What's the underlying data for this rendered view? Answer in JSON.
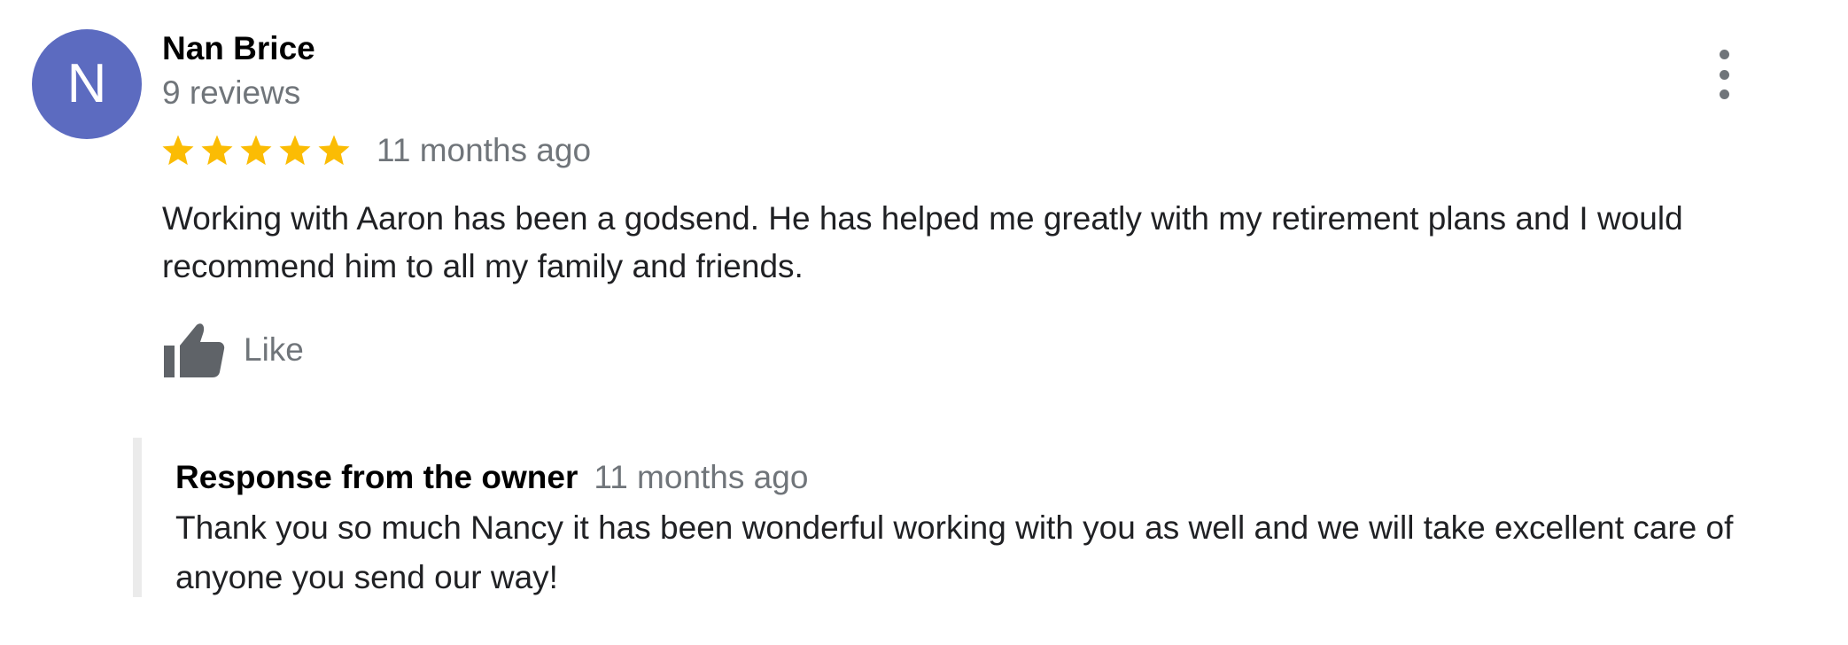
{
  "review": {
    "avatar_letter": "N",
    "avatar_color": "#5c6bc0",
    "reviewer_name": "Nan Brice",
    "review_count": "9 reviews",
    "rating": 5,
    "rating_max": 5,
    "star_color": "#fbbc04",
    "date": "11 months ago",
    "text": "Working with Aaron has been a godsend. He has helped me greatly with my retirement plans and I would recommend him to all my family and friends.",
    "like_label": "Like",
    "menu_icon": "more-vert-icon",
    "like_icon": "thumbs-up-icon"
  },
  "owner_response": {
    "title": "Response from the owner",
    "date": "11 months ago",
    "text": "Thank you so much Nancy it has been wonderful working with you as well and we will take excellent care of anyone you send our way!"
  }
}
